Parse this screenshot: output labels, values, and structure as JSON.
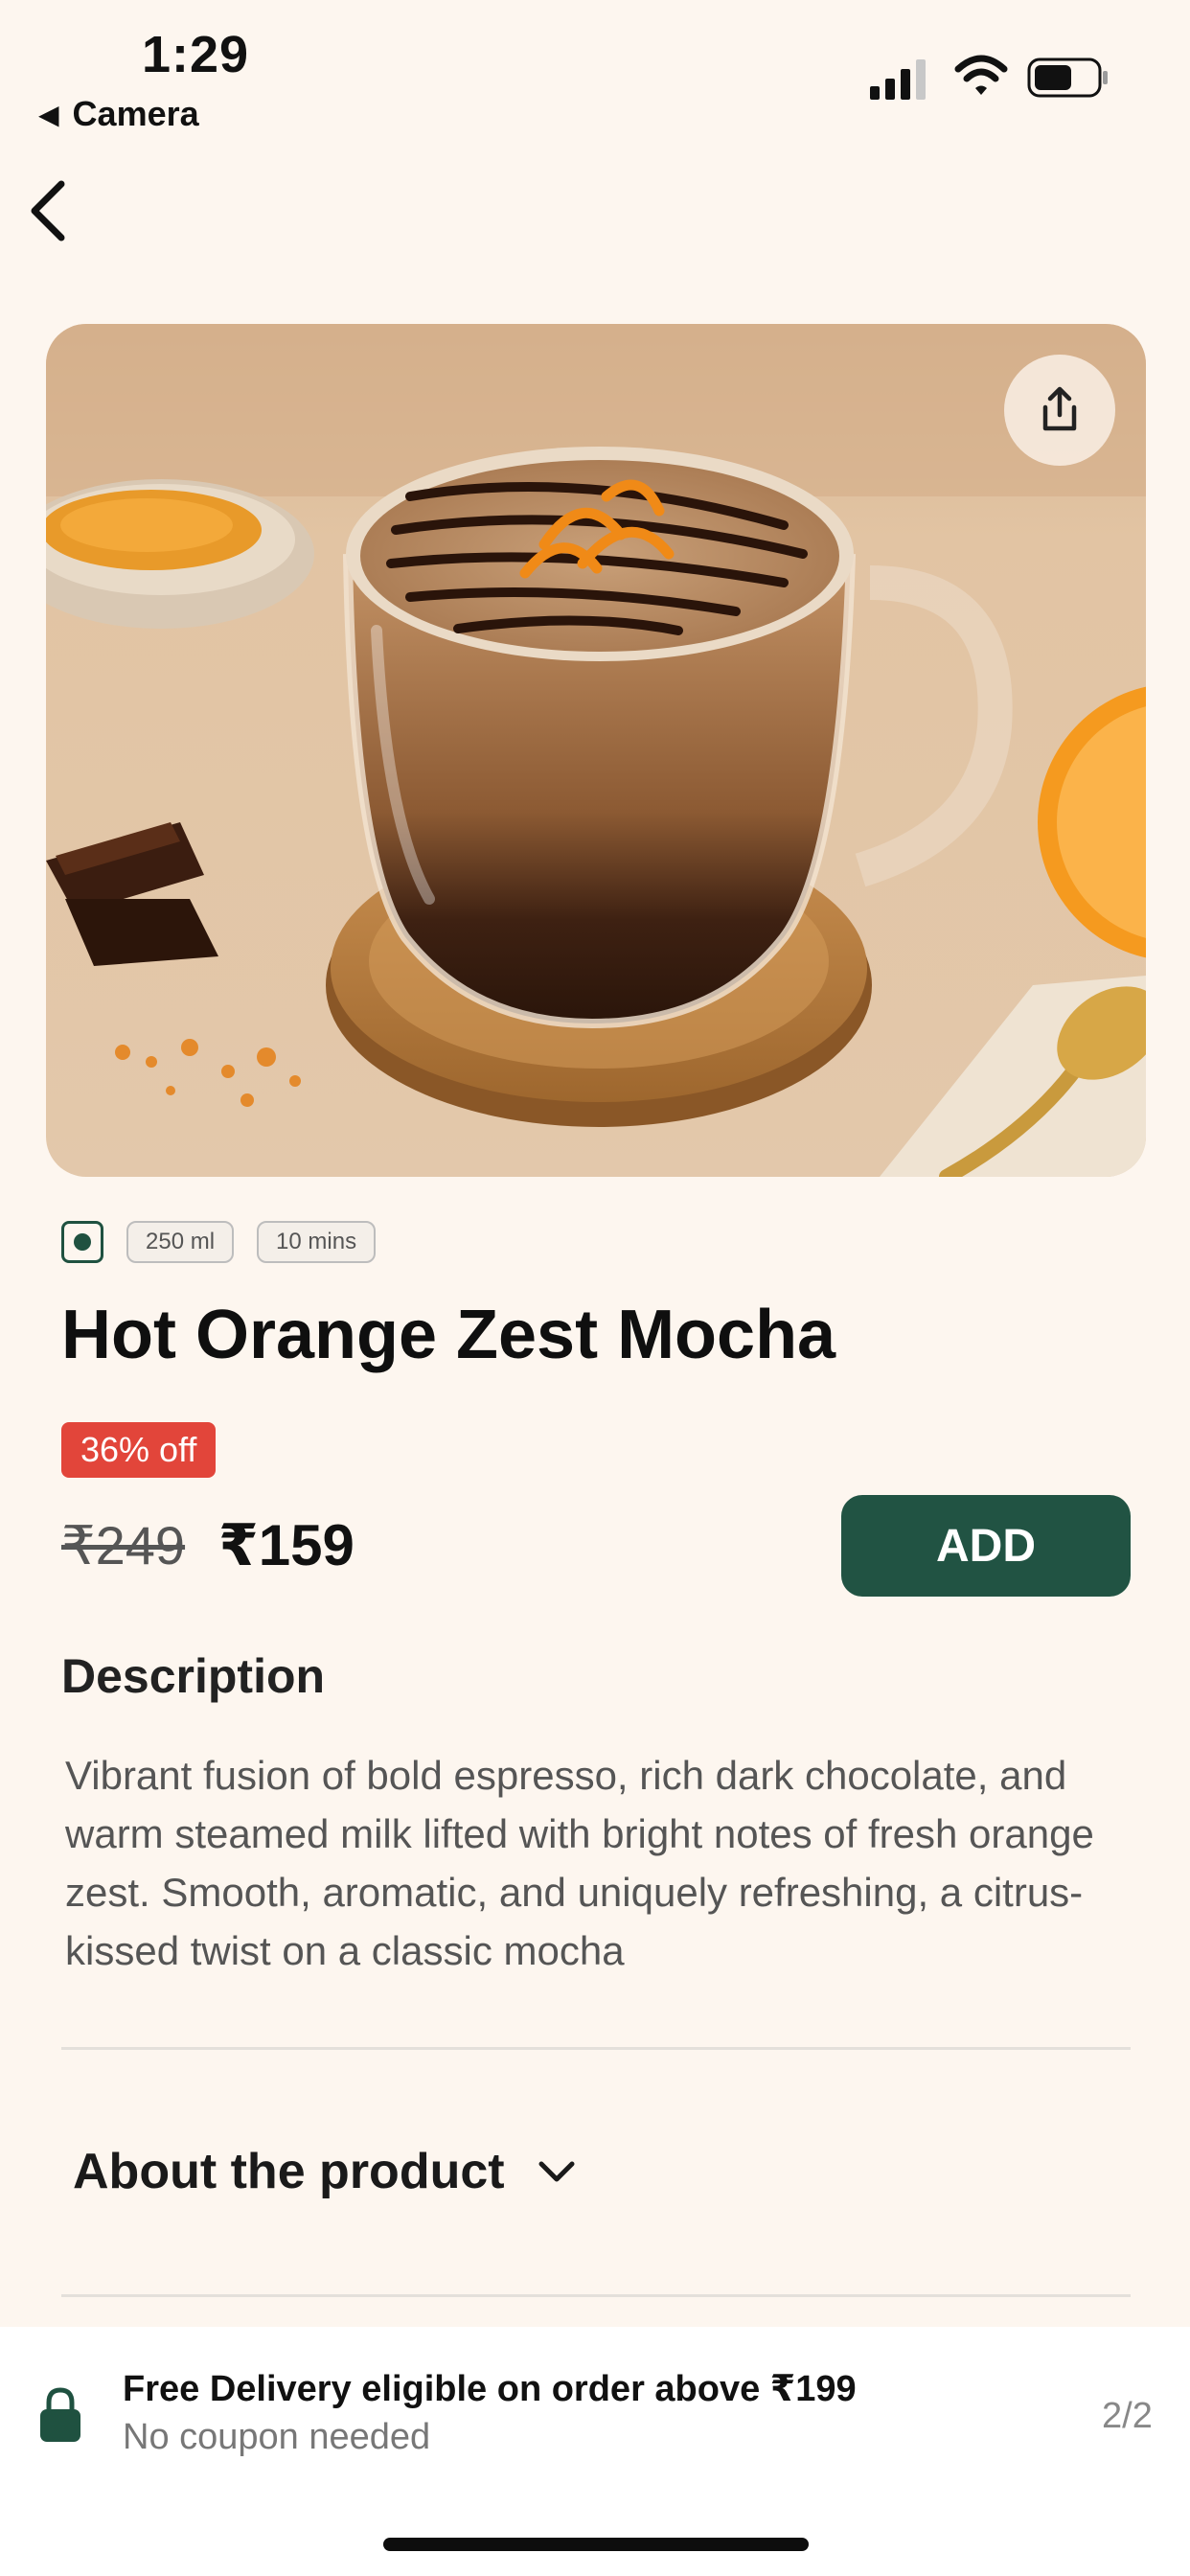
{
  "status_bar": {
    "time": "1:29",
    "back_app": "Camera"
  },
  "product": {
    "volume": "250 ml",
    "prep_time": "10 mins",
    "name": "Hot Orange Zest Mocha",
    "discount": "36% off",
    "mrp": "₹249",
    "price": "₹159",
    "add_label": "ADD"
  },
  "description": {
    "heading": "Description",
    "text": "Vibrant fusion of bold espresso, rich dark chocolate, and warm steamed milk lifted with bright notes of fresh orange zest. Smooth, aromatic, and uniquely refreshing, a citrus-kissed twist on a classic mocha"
  },
  "about": {
    "label": "About the product"
  },
  "bottom_bar": {
    "title": "Free Delivery eligible on order above ₹199",
    "subtitle": "No coupon needed",
    "pager": "2/2"
  },
  "colors": {
    "background": "#fdf6ef",
    "accent": "#215343",
    "discount_badge": "#e2453a"
  },
  "icons": [
    "signal-icon",
    "wifi-icon",
    "battery-icon",
    "back-arrow-icon",
    "share-icon",
    "veg-indicator-icon",
    "chevron-down-icon",
    "lock-icon"
  ]
}
